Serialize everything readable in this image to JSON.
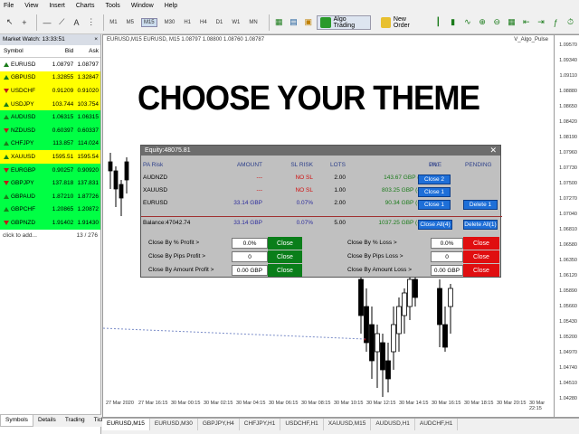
{
  "menu": [
    "File",
    "View",
    "Insert",
    "Charts",
    "Tools",
    "Window",
    "Help"
  ],
  "toolbar": {
    "timeframes": [
      "M1",
      "M5",
      "M15",
      "M30",
      "H1",
      "H4",
      "D1",
      "W1",
      "MN"
    ],
    "active_timeframe": "M15",
    "algo_label": "Algo Trading",
    "new_order_label": "New Order"
  },
  "market_watch": {
    "title": "Market Watch: 13:33:51",
    "headers": {
      "symbol": "Symbol",
      "bid": "Bid",
      "ask": "Ask"
    },
    "rows": [
      {
        "symbol": "EURUSD",
        "bid": "1.08797",
        "ask": "1.08797",
        "dir": "up",
        "bg": "#fff"
      },
      {
        "symbol": "GBPUSD",
        "bid": "1.32855",
        "ask": "1.32847",
        "dir": "up",
        "bg": "#ffff00"
      },
      {
        "symbol": "USDCHF",
        "bid": "0.91209",
        "ask": "0.91020",
        "dir": "dn",
        "bg": "#ffff00"
      },
      {
        "symbol": "USDJPY",
        "bid": "103.744",
        "ask": "103.754",
        "dir": "up",
        "bg": "#ffff00"
      },
      {
        "symbol": "AUDUSD",
        "bid": "1.06315",
        "ask": "1.06315",
        "dir": "up",
        "bg": "#00ff44"
      },
      {
        "symbol": "NZDUSD",
        "bid": "0.60397",
        "ask": "0.60337",
        "dir": "dn",
        "bg": "#00ff44"
      },
      {
        "symbol": "CHFJPY",
        "bid": "113.857",
        "ask": "114.024",
        "dir": "up",
        "bg": "#00ff44"
      },
      {
        "symbol": "XAUUSD",
        "bid": "1595.51",
        "ask": "1595.54",
        "dir": "up",
        "bg": "#ffff00"
      },
      {
        "symbol": "EURGBP",
        "bid": "0.90257",
        "ask": "0.90920",
        "dir": "dn",
        "bg": "#00ff44"
      },
      {
        "symbol": "GBPJPY",
        "bid": "137.818",
        "ask": "137.831",
        "dir": "dn",
        "bg": "#00ff44"
      },
      {
        "symbol": "GBPAUD",
        "bid": "1.87210",
        "ask": "1.87726",
        "dir": "up",
        "bg": "#00ff44"
      },
      {
        "symbol": "GBPCHF",
        "bid": "1.20865",
        "ask": "1.20872",
        "dir": "up",
        "bg": "#00ff44"
      },
      {
        "symbol": "GBPNZD",
        "bid": "1.91402",
        "ask": "1.91430",
        "dir": "dn",
        "bg": "#00ff44"
      }
    ],
    "footer_add": "click to add...",
    "footer_count": "13 / 276",
    "tabs": [
      "Symbols",
      "Details",
      "Trading",
      "Ticks"
    ]
  },
  "chart": {
    "header": "EURUSD,M15  EURUSD, M15  1.08797  1.08800  1.08760  1.08787",
    "header_right": "V_Algo_Pulse",
    "price_labels": [
      "1.09570",
      "1.09340",
      "1.09110",
      "1.08880",
      "1.08650",
      "1.08420",
      "1.08190",
      "1.07960",
      "1.07730",
      "1.07500",
      "1.07270",
      "1.07040",
      "1.06810",
      "1.06580",
      "1.06350",
      "1.06120",
      "1.05890",
      "1.05660",
      "1.05430",
      "1.05200",
      "1.04970",
      "1.04740",
      "1.04510",
      "1.04280"
    ],
    "time_labels": [
      "27 Mar 2020",
      "27 Mar 16:15",
      "30 Mar 00:15",
      "30 Mar 02:15",
      "30 Mar 04:15",
      "30 Mar 06:15",
      "30 Mar 08:15",
      "30 Mar 10:15",
      "30 Mar 12:15",
      "30 Mar 14:15",
      "30 Mar 16:15",
      "30 Mar 18:15",
      "30 Mar 20:15",
      "30 Mar 22:15"
    ],
    "tabs": [
      "EURUSD,M15",
      "EURUSD,M30",
      "GBPJPY,H4",
      "CHFJPY,H1",
      "USDCHF,H1",
      "XAUUSD,M15",
      "AUDUSD,H1",
      "AUDCHF,H1"
    ],
    "active_tab": "EURUSD,M15"
  },
  "banner": {
    "text": "CHOOSE YOUR THEME"
  },
  "panel": {
    "title": "Equity:48075.81",
    "headers": {
      "pair": "PA Risk",
      "amount": "AMOUNT",
      "sl_risk": "SL RISK",
      "lots": "LOTS",
      "pl": "P/L",
      "live": "LIVE",
      "pending": "PENDING"
    },
    "rows": [
      {
        "pair": "AUDNZD",
        "amount": "---",
        "sl_risk": "NO SL",
        "lots": "2.00",
        "pl": "143.67 GBP (0.31%)",
        "live": "Close 2",
        "pending": ""
      },
      {
        "pair": "XAUUSD",
        "amount": "---",
        "sl_risk": "NO SL",
        "lots": "1.00",
        "pl": "803.25 GBP (-1.71%)",
        "live": "Close 1",
        "pending": ""
      },
      {
        "pair": "EURUSD",
        "amount": "33.14 GBP",
        "sl_risk": "0.07%",
        "lots": "2.00",
        "pl": "90.34 GBP (-0.19%)",
        "live": "Close 1",
        "pending": "Delete 1"
      }
    ],
    "balance": {
      "label": "Balance:47042.74",
      "amount": "33.14 GBP",
      "sl_risk": "0.07%",
      "lots": "5.00",
      "pl": "1037.25 GBP (-2.20%)",
      "live": "Close All(4)",
      "pending": "Delete All(1)"
    },
    "close_rows": [
      {
        "left_label": "Close By % Profit >",
        "left_value": "0.0%",
        "right_label": "Close By % Loss >",
        "right_value": "0.0%"
      },
      {
        "left_label": "Close By Pips Profit >",
        "left_value": "0",
        "right_label": "Close By Pips Loss >",
        "right_value": "0"
      },
      {
        "left_label": "Close By Amount Profit >",
        "left_value": "0.00 GBP",
        "right_label": "Close By Amount Loss >",
        "right_value": "0.00 GBP"
      }
    ],
    "close_btn": "Close"
  }
}
